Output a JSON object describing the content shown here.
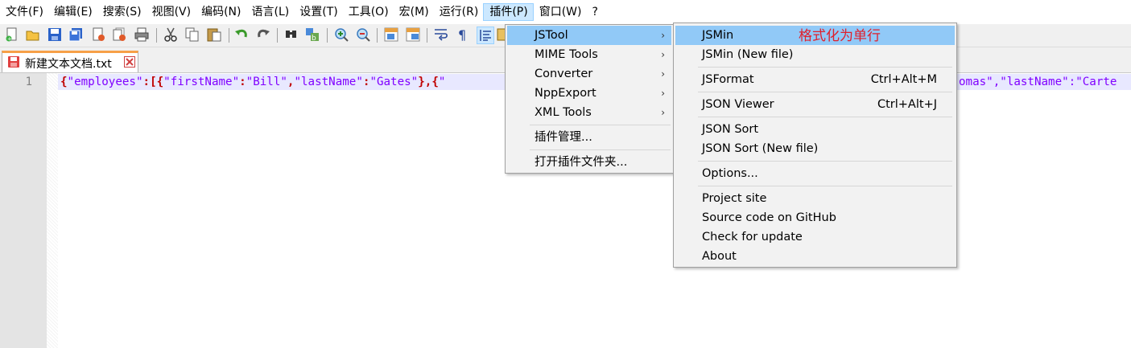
{
  "menubar": {
    "items": [
      "文件(F)",
      "编辑(E)",
      "搜索(S)",
      "视图(V)",
      "编码(N)",
      "语言(L)",
      "设置(T)",
      "工具(O)",
      "宏(M)",
      "运行(R)",
      "插件(P)",
      "窗口(W)",
      "?"
    ]
  },
  "toolbar": {
    "icons": [
      "new-file-icon",
      "open-file-icon",
      "save-icon",
      "save-all-icon",
      "close-icon",
      "close-all-icon",
      "print-icon",
      "cut-icon",
      "copy-icon",
      "paste-icon",
      "undo-icon",
      "redo-icon",
      "find-icon",
      "replace-icon",
      "zoom-in-icon",
      "zoom-out-icon",
      "sync-vertical-icon",
      "sync-horizontal-icon",
      "word-wrap-icon",
      "show-all-chars-icon",
      "indent-guide-icon"
    ]
  },
  "tab": {
    "title": "新建文本文档.txt"
  },
  "editor": {
    "line_number": "1",
    "code_left": "{\"employees\":[{\"firstName\":\"Bill\",\"lastName\":\"Gates\"},{\"",
    "code_right": "omas\",\"lastName\":\"Carte"
  },
  "plugin_menu": {
    "items": [
      "JSTool",
      "MIME Tools",
      "Converter",
      "NppExport",
      "XML Tools",
      "插件管理...",
      "打开插件文件夹..."
    ]
  },
  "jstool_menu": {
    "items": [
      {
        "label": "JSMin",
        "shortcut": ""
      },
      {
        "label": "JSMin (New file)",
        "shortcut": ""
      },
      {
        "label": "JSFormat",
        "shortcut": "Ctrl+Alt+M"
      },
      {
        "label": "JSON Viewer",
        "shortcut": "Ctrl+Alt+J"
      },
      {
        "label": "JSON Sort",
        "shortcut": ""
      },
      {
        "label": "JSON Sort (New file)",
        "shortcut": ""
      },
      {
        "label": "Options...",
        "shortcut": ""
      },
      {
        "label": "Project site",
        "shortcut": ""
      },
      {
        "label": "Source code on GitHub",
        "shortcut": ""
      },
      {
        "label": "Check for update",
        "shortcut": ""
      },
      {
        "label": "About",
        "shortcut": ""
      }
    ]
  },
  "annotation": "格式化为单行",
  "colors": {
    "menu_highlight": "#91c9f7",
    "annotation": "#e0202c",
    "tab_accent": "#f7a048",
    "string": "#8000ff",
    "punctuation": "#c00000"
  }
}
